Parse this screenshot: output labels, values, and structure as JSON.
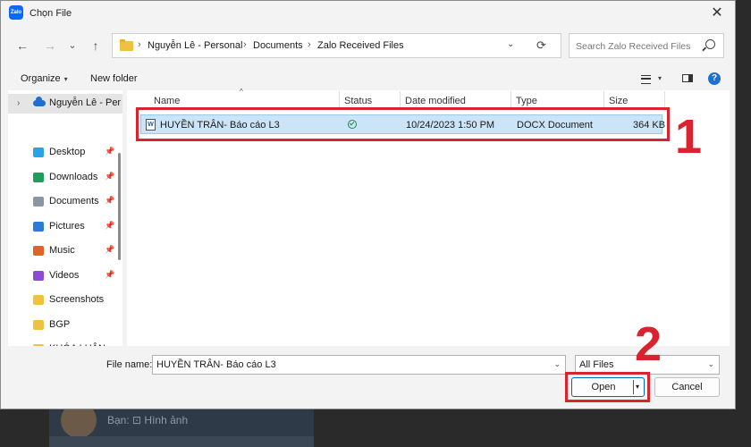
{
  "background": {
    "preview_text": "Bạn: ⊡ Hình ảnh"
  },
  "dialog": {
    "app_icon_text": "Zalo",
    "title": "Chọn File",
    "close_symbol": "✕"
  },
  "nav": {
    "back_symbol": "←",
    "forward_symbol": "→",
    "recent_symbol": "⌄",
    "up_symbol": "↑",
    "breadcrumb": [
      "Nguyễn Lê - Personal",
      "Documents",
      "Zalo Received Files"
    ],
    "separator": "›",
    "dropdown_symbol": "⌄",
    "refresh_symbol": "⟳",
    "search_placeholder": "Search Zalo Received Files"
  },
  "toolbar": {
    "organize_label": "Organize",
    "new_folder_label": "New folder",
    "caret": "▾",
    "help_symbol": "?"
  },
  "sidebar": {
    "chevron": "›",
    "pin": "📌",
    "onedrive_label": "Nguyễn Lê - Per",
    "items": [
      {
        "label": "Desktop",
        "color": "#2aa3e6",
        "pinned": true
      },
      {
        "label": "Downloads",
        "color": "#1e9e5a",
        "pinned": true
      },
      {
        "label": "Documents",
        "color": "#8a96a3",
        "pinned": true
      },
      {
        "label": "Pictures",
        "color": "#2b7bd6",
        "pinned": true
      },
      {
        "label": "Music",
        "color": "#e0632a",
        "pinned": true
      },
      {
        "label": "Videos",
        "color": "#8c4bd6",
        "pinned": true
      },
      {
        "label": "Screenshots",
        "color": "#f0c040",
        "pinned": false
      },
      {
        "label": "BGP",
        "color": "#f0c040",
        "pinned": false
      },
      {
        "label": "KHÓA LUẬN",
        "color": "#f0c040",
        "pinned": false
      }
    ]
  },
  "files": {
    "sort_symbol": "^",
    "columns": {
      "name": "Name",
      "status": "Status",
      "date_modified": "Date modified",
      "type": "Type",
      "size": "Size"
    },
    "rows": [
      {
        "icon_letter": "W",
        "name": "HUYỀN TRÂN- Báo cáo L3",
        "date_modified": "10/24/2023 1:50 PM",
        "type": "DOCX Document",
        "size": "364 KB"
      }
    ]
  },
  "footer": {
    "file_name_label": "File name:",
    "file_name_value": "HUYỀN TRÂN- Báo cáo L3",
    "dropdown_symbol": "⌄",
    "file_type_value": "All Files",
    "open_label": "Open",
    "open_dd_symbol": "▾",
    "cancel_label": "Cancel"
  },
  "annotations": {
    "step1": "1",
    "step2": "2",
    "highlight_color": "#d9242f"
  }
}
